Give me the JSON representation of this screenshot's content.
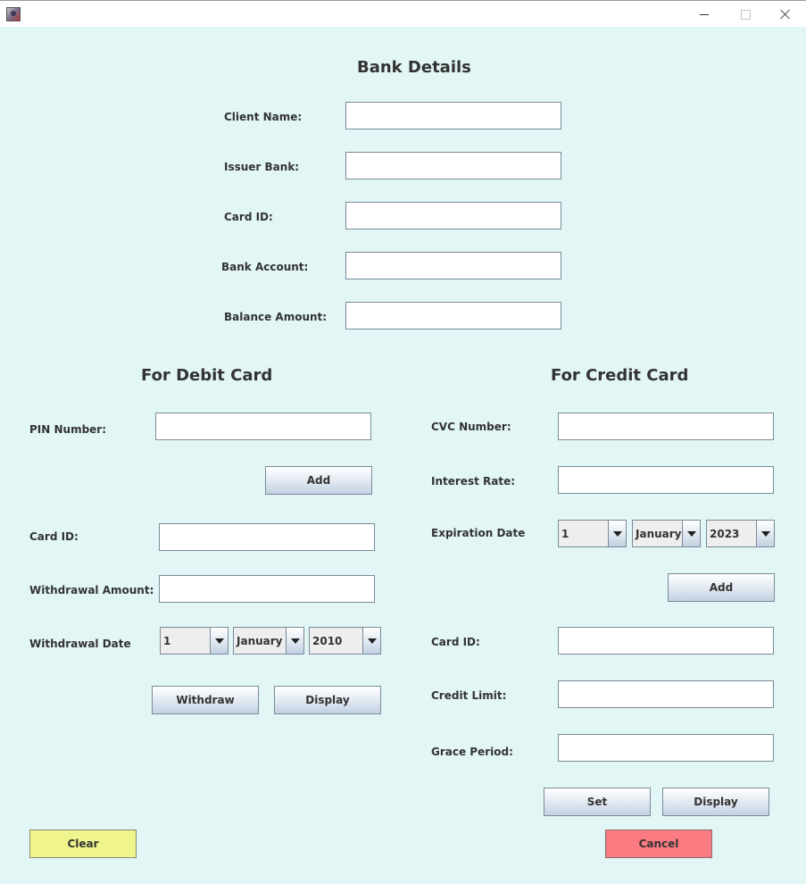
{
  "window": {
    "title": ""
  },
  "header": {
    "title": "Bank Details"
  },
  "bank": {
    "client_name_label": "Client Name:",
    "issuer_bank_label": "Issuer Bank:",
    "card_id_label": "Card ID:",
    "bank_account_label": "Bank Account:",
    "balance_amount_label": "Balance Amount:"
  },
  "debit": {
    "heading": "For Debit Card",
    "pin_label": "PIN Number:",
    "add_label": "Add",
    "card_id_label": "Card ID:",
    "withdrawal_amount_label": "Withdrawal Amount:",
    "withdrawal_date_label": "Withdrawal Date",
    "day": "1",
    "month": "January",
    "year": "2010",
    "withdraw_label": "Withdraw",
    "display_label": "Display"
  },
  "credit": {
    "heading": "For Credit Card",
    "cvc_label": "CVC Number:",
    "interest_rate_label": "Interest Rate:",
    "expiration_date_label": "Expiration Date",
    "day": "1",
    "month": "January",
    "year": "2023",
    "add_label": "Add",
    "card_id_label": "Card ID:",
    "credit_limit_label": "Credit Limit:",
    "grace_period_label": "Grace Period:",
    "set_label": "Set",
    "display_label": "Display"
  },
  "footer": {
    "clear_label": "Clear",
    "cancel_label": "Cancel"
  },
  "colors": {
    "background": "#e2f6f6",
    "clear": "#eff48c",
    "cancel": "#fc7b82"
  }
}
